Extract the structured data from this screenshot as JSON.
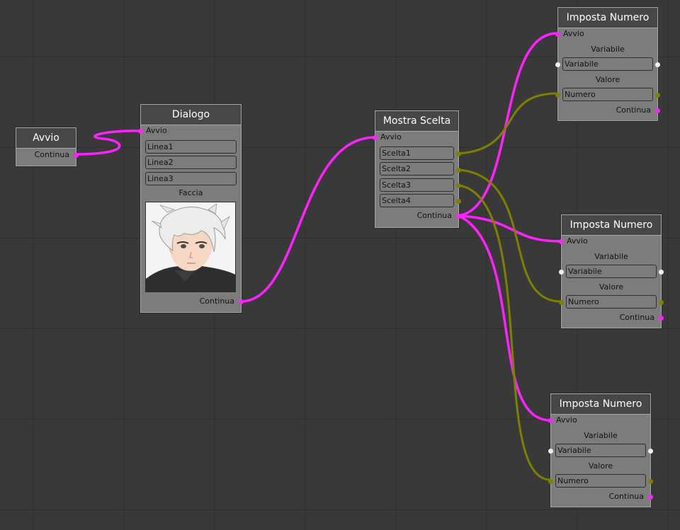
{
  "colors": {
    "flow_wire": "#ff22ff",
    "value_wire": "#808000"
  },
  "nodes": {
    "avvio": {
      "title": "Avvio",
      "output": "Continua"
    },
    "dialogo": {
      "title": "Dialogo",
      "input": "Avvio",
      "lines": [
        "Linea1",
        "Linea2",
        "Linea3"
      ],
      "face_label": "Faccia",
      "face_icon": "character-portrait",
      "output": "Continua"
    },
    "mostra_scelta": {
      "title": "Mostra Scelta",
      "input": "Avvio",
      "choices": [
        "Scelta1",
        "Scelta2",
        "Scelta3",
        "Scelta4"
      ],
      "output": "Continua"
    },
    "imposta_numero": [
      {
        "title": "Imposta Numero",
        "input": "Avvio",
        "variable_label": "Variabile",
        "variable_value": "Variabile",
        "value_label": "Valore",
        "value_value": "Numero",
        "output": "Continua"
      },
      {
        "title": "Imposta Numero",
        "input": "Avvio",
        "variable_label": "Variabile",
        "variable_value": "Variabile",
        "value_label": "Valore",
        "value_value": "Numero",
        "output": "Continua"
      },
      {
        "title": "Imposta Numero",
        "input": "Avvio",
        "variable_label": "Variabile",
        "variable_value": "Variabile",
        "value_label": "Valore",
        "value_value": "Numero",
        "output": "Continua"
      }
    ]
  }
}
